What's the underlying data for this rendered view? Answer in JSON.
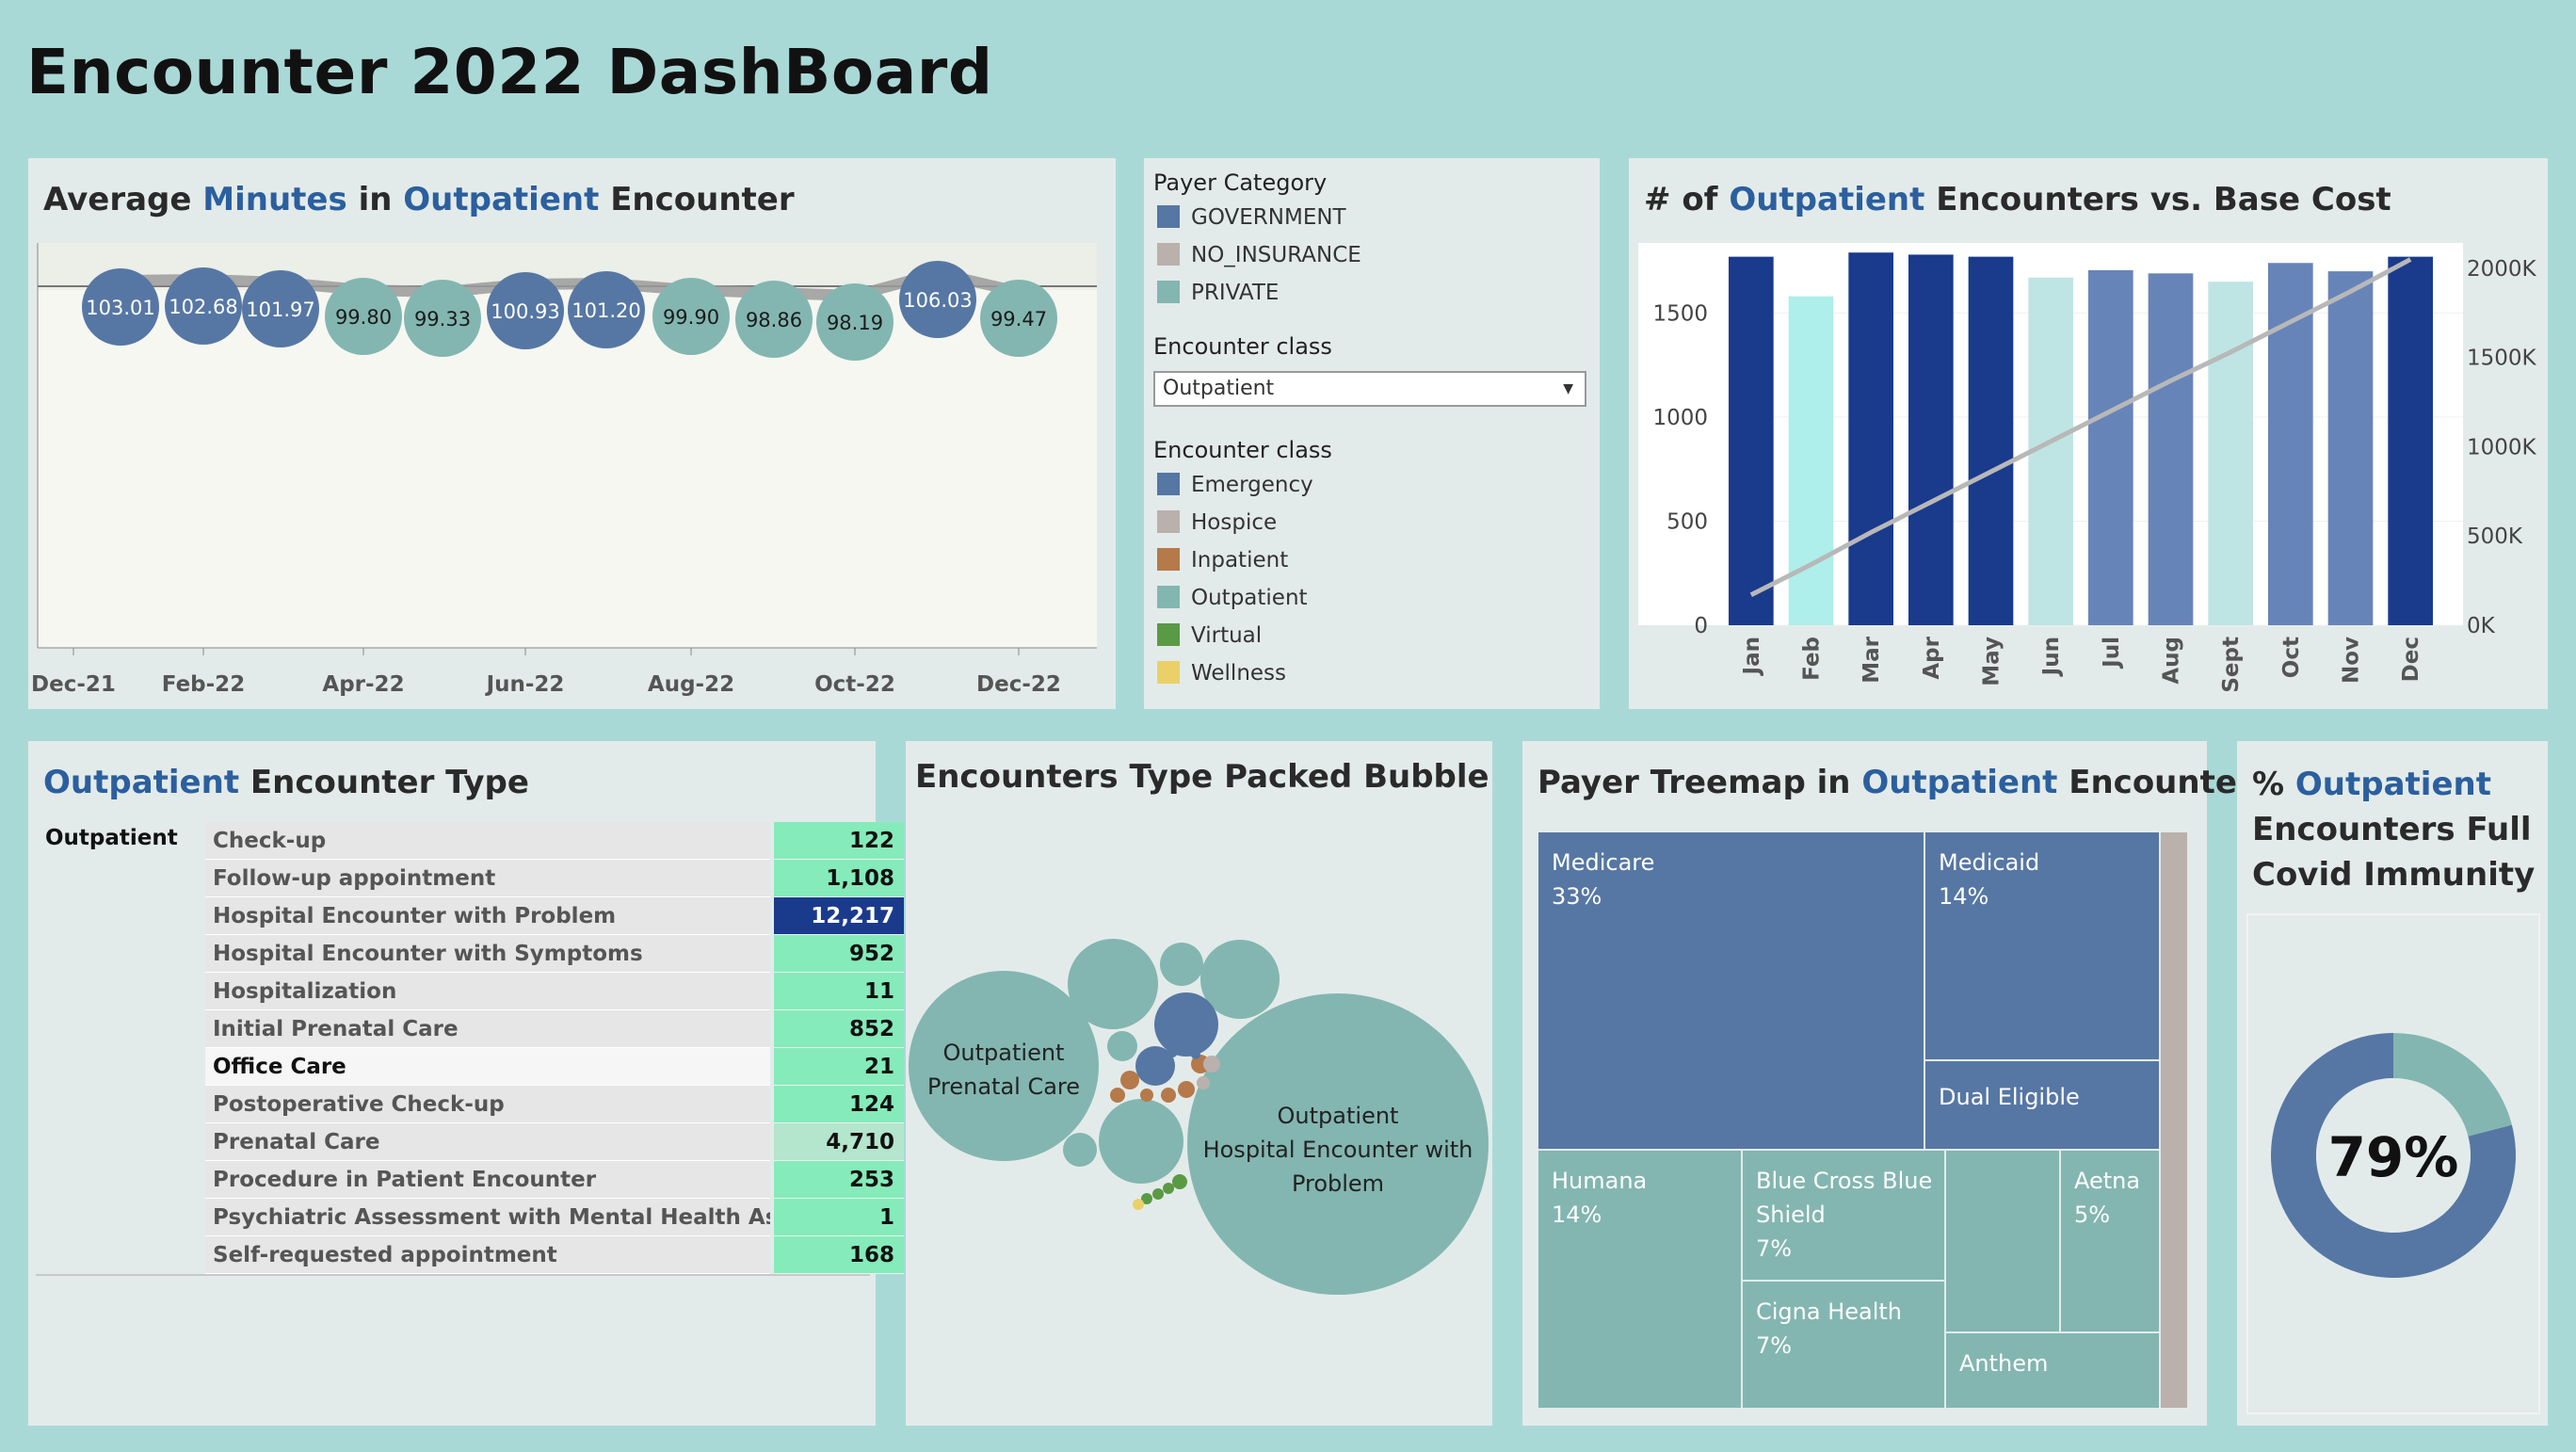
{
  "title": "Encounter 2022 DashBoard",
  "avg_minutes": {
    "title_parts": [
      "Average ",
      "Minutes",
      " in ",
      "Outpatient",
      " Encounter"
    ],
    "x_labels": [
      "Dec-21",
      "Feb-22",
      "Apr-22",
      "Jun-22",
      "Aug-22",
      "Oct-22",
      "Dec-22"
    ],
    "points": [
      {
        "label": "103.01",
        "value": 103.01,
        "color": "#5677a4"
      },
      {
        "label": "102.68",
        "value": 102.68,
        "color": "#5677a4"
      },
      {
        "label": "101.97",
        "value": 101.97,
        "color": "#5677a4"
      },
      {
        "label": "99.80",
        "value": 99.8,
        "color": "#83b6b1"
      },
      {
        "label": "99.33",
        "value": 99.33,
        "color": "#83b6b1"
      },
      {
        "label": "100.93",
        "value": 100.93,
        "color": "#5677a4"
      },
      {
        "label": "101.20",
        "value": 101.2,
        "color": "#5677a4"
      },
      {
        "label": "99.90",
        "value": 99.9,
        "color": "#83b6b1"
      },
      {
        "label": "98.86",
        "value": 98.86,
        "color": "#83b6b1"
      },
      {
        "label": "98.19",
        "value": 98.19,
        "color": "#83b6b1"
      },
      {
        "label": "106.03",
        "value": 106.03,
        "color": "#5677a4"
      },
      {
        "label": "99.47",
        "value": 99.47,
        "color": "#83b6b1"
      }
    ]
  },
  "filters": {
    "payer_category_title": "Payer Category",
    "payer_categories": [
      {
        "label": "GOVERNMENT",
        "color": "#5677a4"
      },
      {
        "label": "NO_INSURANCE",
        "color": "#bab0ac"
      },
      {
        "label": "PRIVATE",
        "color": "#83b6b1"
      }
    ],
    "encounter_class_title": "Encounter class",
    "encounter_class_selected": "Outpatient",
    "encounter_class_legend_title": "Encounter class",
    "encounter_classes": [
      {
        "label": "Emergency",
        "color": "#5677a4"
      },
      {
        "label": "Hospice",
        "color": "#bab0ac"
      },
      {
        "label": "Inpatient",
        "color": "#b5794a"
      },
      {
        "label": "Outpatient",
        "color": "#83b6b1"
      },
      {
        "label": "Virtual",
        "color": "#5a9a45"
      },
      {
        "label": "Wellness",
        "color": "#ead067"
      }
    ]
  },
  "chart_data": [
    {
      "type": "line",
      "title": "Average Minutes in Outpatient Encounter",
      "x": [
        "Jan-22",
        "Feb-22",
        "Mar-22",
        "Apr-22",
        "May-22",
        "Jun-22",
        "Jul-22",
        "Aug-22",
        "Sep-22",
        "Oct-22",
        "Nov-22",
        "Dec-22"
      ],
      "values": [
        103.01,
        102.68,
        101.97,
        99.8,
        99.33,
        100.93,
        101.2,
        99.9,
        98.86,
        98.19,
        106.03,
        99.47
      ]
    },
    {
      "type": "bar",
      "title": "# of Outpatient Encounters vs. Base Cost",
      "categories": [
        "Jan",
        "Feb",
        "Mar",
        "Apr",
        "May",
        "Jun",
        "Jul",
        "Aug",
        "Sept",
        "Oct",
        "Nov",
        "Dec"
      ],
      "values": [
        1770,
        1580,
        1790,
        1780,
        1770,
        1670,
        1705,
        1690,
        1650,
        1740,
        1700,
        1770
      ],
      "colors": [
        "#1a3a8c",
        "#aeeeeb",
        "#1a3a8c",
        "#1a3a8c",
        "#1a3a8c",
        "#bfe4e4",
        "#6784b9",
        "#6784b9",
        "#bfe4e4",
        "#6784b9",
        "#6784b9",
        "#1a3a8c"
      ],
      "line_values": [
        170,
        340,
        520,
        690,
        860,
        1030,
        1200,
        1370,
        1530,
        1700,
        1870,
        2050
      ],
      "left_ticks": [
        "0",
        "500",
        "1000",
        "1500"
      ],
      "right_ticks": [
        "0K",
        "500K",
        "1000K",
        "1500K",
        "2000K"
      ],
      "ylim": [
        0,
        1800
      ],
      "y2lim": [
        0,
        2100
      ]
    },
    {
      "type": "table",
      "title": "Outpatient Encounter Type",
      "rows": [
        {
          "name": "Check-up",
          "value": 122
        },
        {
          "name": "Follow-up appointment",
          "value": 1108
        },
        {
          "name": "Hospital Encounter with Problem",
          "value": 12217
        },
        {
          "name": "Hospital Encounter with Symptoms",
          "value": 952
        },
        {
          "name": "Hospitalization",
          "value": 11
        },
        {
          "name": "Initial Prenatal Care",
          "value": 852
        },
        {
          "name": "Office Care",
          "value": 21
        },
        {
          "name": "Postoperative Check-up",
          "value": 124
        },
        {
          "name": "Prenatal Care",
          "value": 4710
        },
        {
          "name": "Procedure in Patient Encounter",
          "value": 253
        },
        {
          "name": "Psychiatric Assessment with Mental Health Asse..",
          "value": 1
        },
        {
          "name": "Self-requested appointment",
          "value": 168
        }
      ]
    },
    {
      "type": "pie",
      "title": "% Outpatient Encounters Full Covid Immunity",
      "values": [
        79,
        21
      ]
    }
  ],
  "encounter_type": {
    "title_parts": [
      "Outpatient",
      " Encounter Type"
    ],
    "class_label": "Outpatient",
    "rows": [
      {
        "name": "Check-up",
        "value": "122",
        "bg": "#85ebba",
        "fg": "#111"
      },
      {
        "name": "Follow-up appointment",
        "value": "1,108",
        "bg": "#85ebba",
        "fg": "#111"
      },
      {
        "name": "Hospital Encounter with Problem",
        "value": "12,217",
        "bg": "#1a3a8c",
        "fg": "#ffffff"
      },
      {
        "name": "Hospital Encounter with Symptoms",
        "value": "952",
        "bg": "#85ebba",
        "fg": "#111"
      },
      {
        "name": "Hospitalization",
        "value": "11",
        "bg": "#85ebba",
        "fg": "#111"
      },
      {
        "name": "Initial Prenatal Care",
        "value": "852",
        "bg": "#85ebba",
        "fg": "#111"
      },
      {
        "name": "Office Care",
        "value": "21",
        "bg": "#85ebba",
        "fg": "#111"
      },
      {
        "name": "Postoperative Check-up",
        "value": "124",
        "bg": "#85ebba",
        "fg": "#111"
      },
      {
        "name": "Prenatal Care",
        "value": "4,710",
        "bg": "#b4e5cd",
        "fg": "#111"
      },
      {
        "name": "Procedure in Patient Encounter",
        "value": "253",
        "bg": "#85ebba",
        "fg": "#111"
      },
      {
        "name": "Psychiatric Assessment with Mental Health Asse..",
        "value": "1",
        "bg": "#85ebba",
        "fg": "#111"
      },
      {
        "name": "Self-requested appointment",
        "value": "168",
        "bg": "#85ebba",
        "fg": "#111"
      }
    ]
  },
  "bubble": {
    "title": "Encounters Type Packed Bubble",
    "big_label": [
      "Outpatient",
      "Hospital Encounter with",
      "Problem"
    ],
    "mid_label": [
      "Outpatient",
      "Prenatal Care"
    ]
  },
  "treemap": {
    "title_parts": [
      "Payer Treemap in ",
      "Outpatient",
      " Encounter"
    ],
    "cells": {
      "medicare": {
        "name": "Medicare",
        "pct": "33%"
      },
      "medicaid": {
        "name": "Medicaid",
        "pct": "14%"
      },
      "dual": {
        "name": "Dual Eligible"
      },
      "humana": {
        "name": "Humana",
        "pct": "14%"
      },
      "bcbs": {
        "name": "Blue Cross Blue\nShield",
        "name1": "Blue Cross Blue",
        "name2": "Shield",
        "pct": "7%"
      },
      "cigna": {
        "name": "Cigna Health",
        "pct": "7%"
      },
      "aetna": {
        "name": "Aetna",
        "pct": "5%"
      },
      "anthem": {
        "name": "Anthem"
      }
    }
  },
  "immunity": {
    "title_parts": [
      "% ",
      "Outpatient",
      "Encounters Full",
      "Covid Immunity"
    ],
    "value_label": "79%",
    "pct": 0.79,
    "colors": {
      "main": "#5677a4",
      "rest": "#83b6b1"
    }
  }
}
